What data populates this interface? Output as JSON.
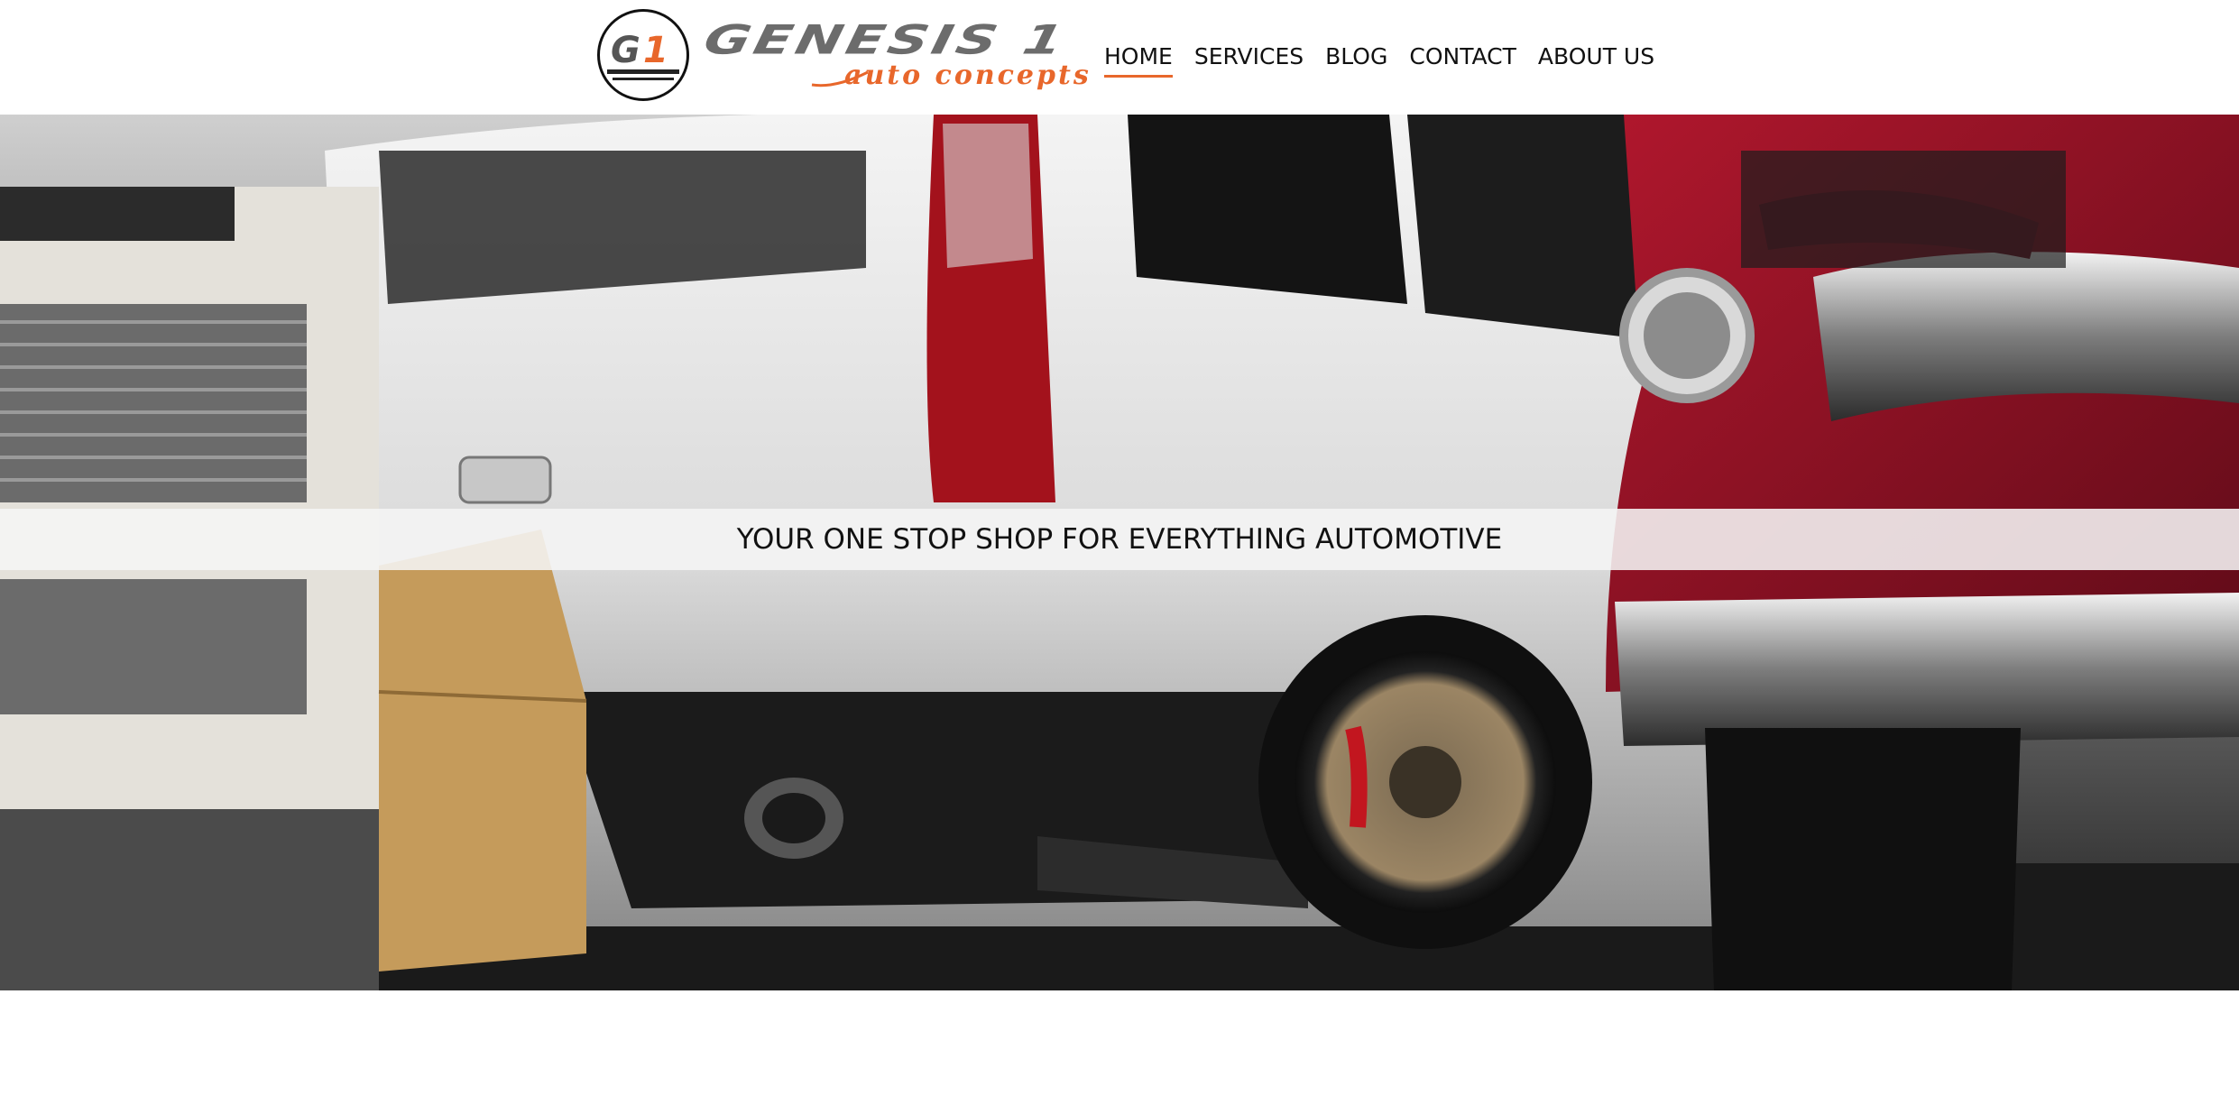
{
  "brand": {
    "badge_text": "G1",
    "wordmark": "GENESIS 1",
    "sub_wordmark": "auto concepts",
    "accent_color": "#e8672b",
    "wordmark_color": "#6c6c6c"
  },
  "nav": {
    "items": [
      {
        "label": "HOME",
        "active": true
      },
      {
        "label": "SERVICES",
        "active": false
      },
      {
        "label": "BLOG",
        "active": false
      },
      {
        "label": "CONTACT",
        "active": false
      },
      {
        "label": "ABOUT US",
        "active": false
      }
    ]
  },
  "hero": {
    "tagline": "YOUR ONE STOP SHOP FOR EVERYTHING AUTOMOTIVE",
    "image_subject": "garage-cars-photo"
  }
}
